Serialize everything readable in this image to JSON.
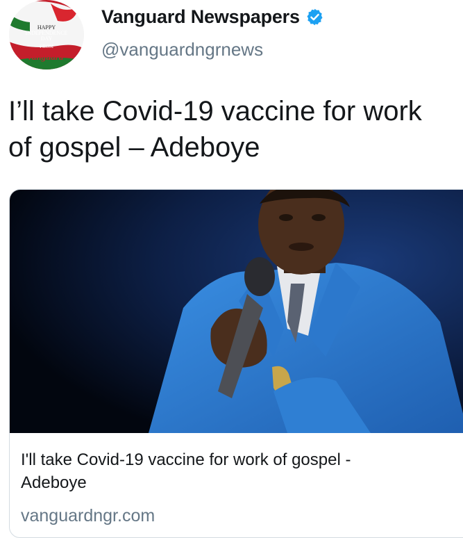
{
  "account": {
    "display_name": "Vanguard Newspapers",
    "handle": "@vanguardngrnews",
    "verified": true,
    "avatar_text": [
      "HAPPY",
      "INDEPENDENCE",
      "DAY",
      "FROM",
      "Vanguard"
    ]
  },
  "tweet": {
    "text_lines": [
      "I’ll take Covid-19 vaccine for work",
      "of gospel – Adeboye"
    ]
  },
  "card": {
    "title_lines": [
      "I'll take Covid-19 vaccine for work of gospel -",
      "Adeboye"
    ],
    "domain": "vanguardngr.com"
  },
  "colors": {
    "verified": "#1da1f2",
    "handle": "#657786",
    "suit": "#2f7fd3",
    "stage_background": "#0a1a3a"
  }
}
